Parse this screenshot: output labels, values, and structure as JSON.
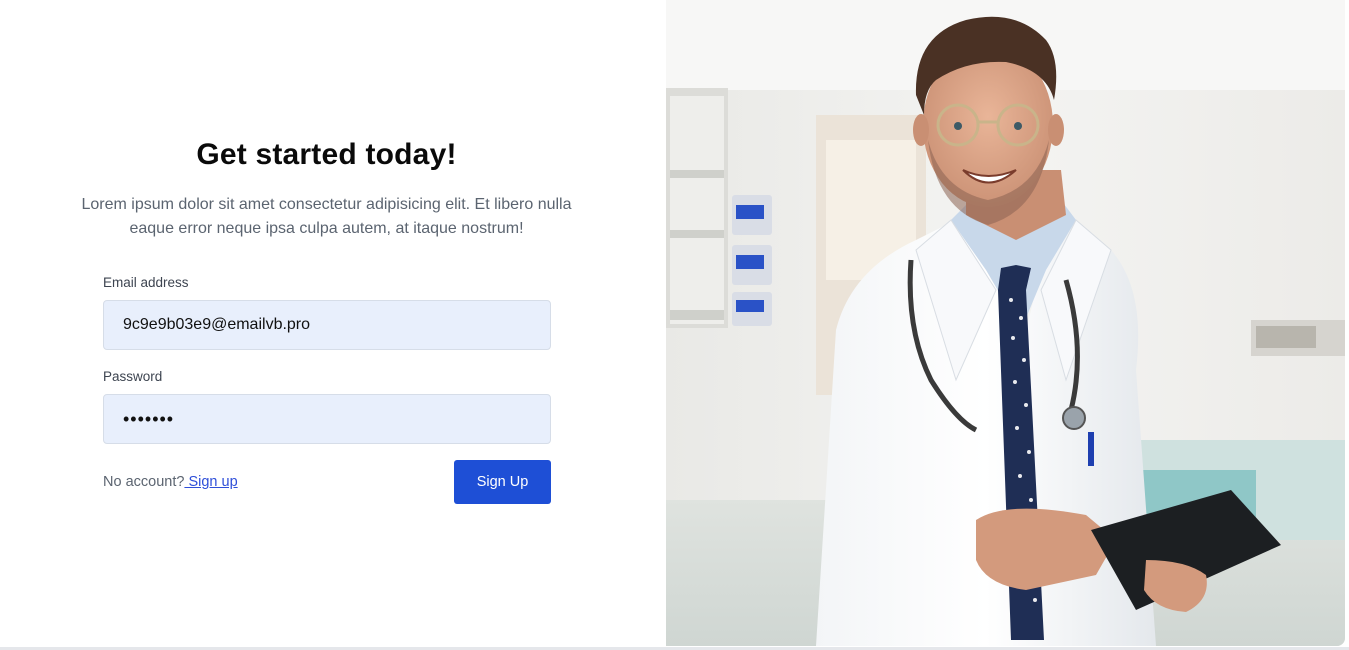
{
  "hero": {
    "title": "Get started today!",
    "subtitle_line1": "Lorem ipsum dolor sit amet consectetur adipisicing elit. Et libero nulla",
    "subtitle_line2": "eaque error neque ipsa culpa autem, at itaque nostrum!"
  },
  "form": {
    "email_label": "Email address",
    "email_value": "9c9e9b03e9@emailvb.pro",
    "password_label": "Password",
    "password_value": "•••••••",
    "no_account_text": "No account?",
    "signup_link": " Sign up",
    "submit_label": "Sign Up"
  },
  "image": {
    "alt": "doctor-photo"
  },
  "colors": {
    "primary": "#1e4fd6",
    "input_bg": "#e8effc",
    "link": "#2f4fd9",
    "muted_text": "#5b6470"
  }
}
